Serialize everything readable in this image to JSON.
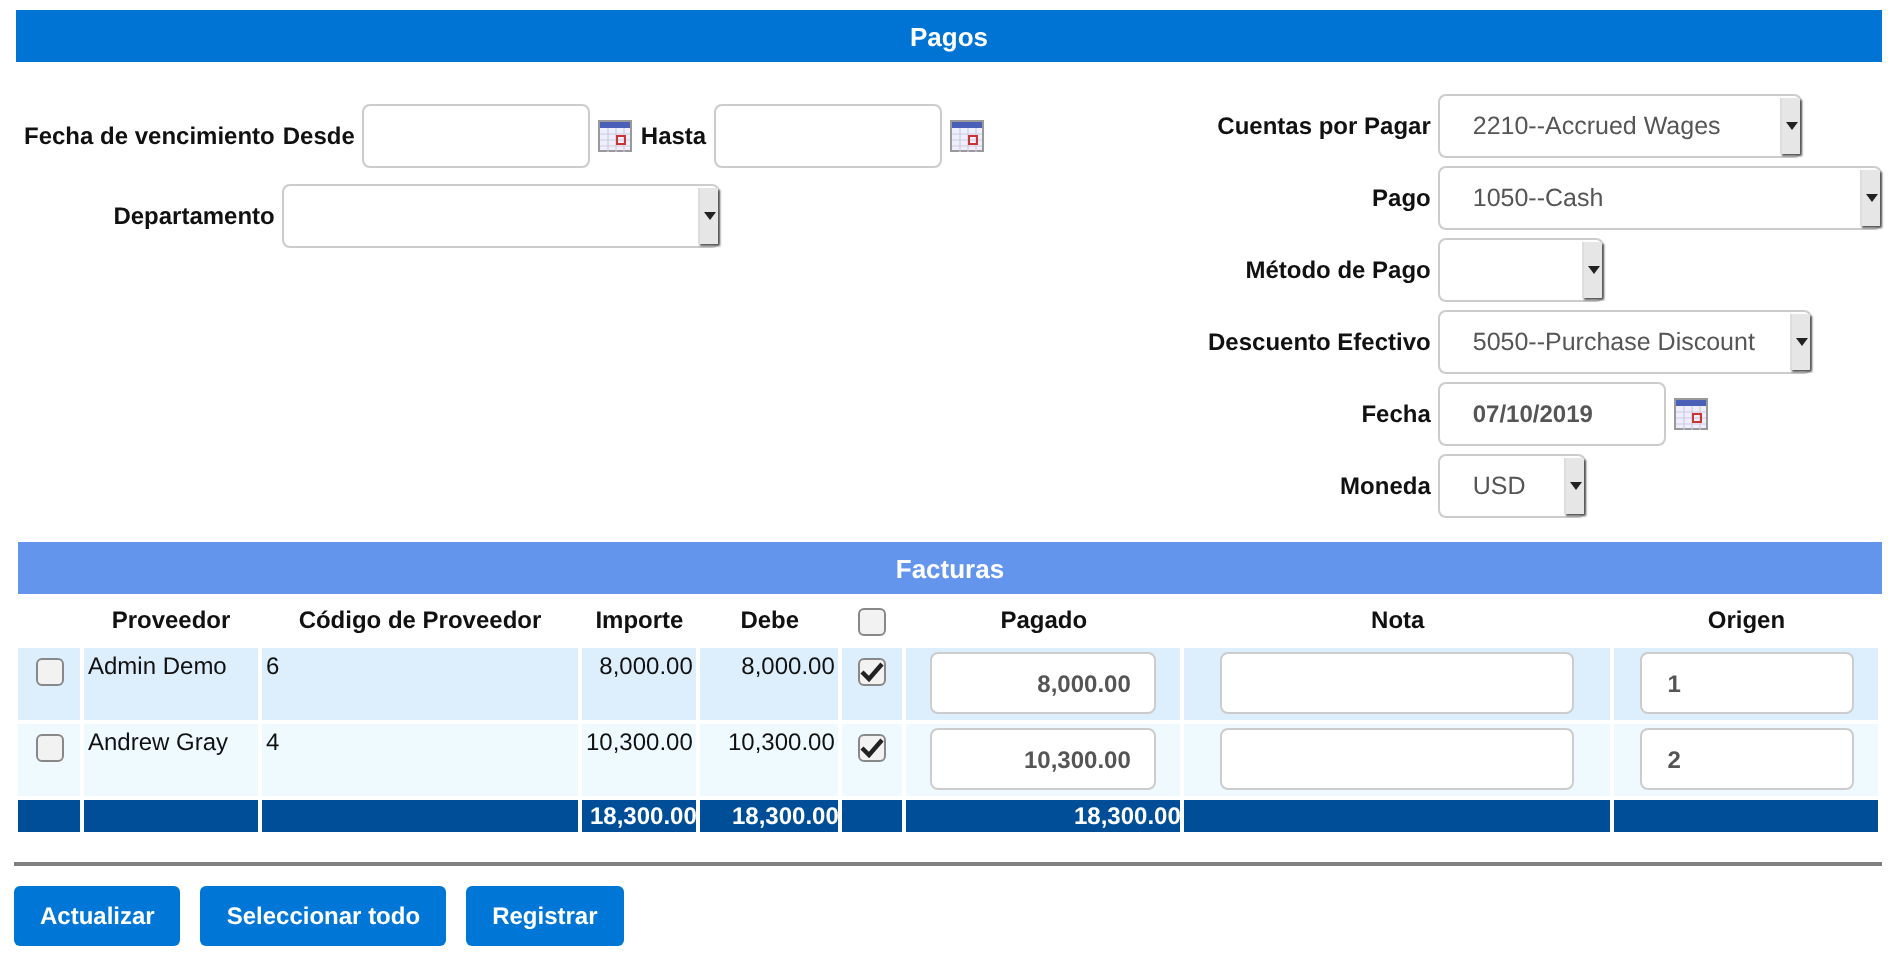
{
  "header": {
    "title": "Pagos"
  },
  "filters": {
    "due_label": "Fecha de vencimiento",
    "from_label": "Desde",
    "to_label": "Hasta",
    "department_label": "Departamento"
  },
  "settings": [
    {
      "label": "Cuentas por Pagar",
      "kind": "select",
      "value": "2210--Accrued Wages"
    },
    {
      "label": "Pago",
      "kind": "select",
      "value": "1050--Cash"
    },
    {
      "label": "Método de Pago",
      "kind": "select"
    },
    {
      "label": "Descuento Efectivo",
      "kind": "select",
      "value": "5050--Purchase Discount"
    },
    {
      "label": "Fecha",
      "kind": "date",
      "value": "07/10/2019"
    },
    {
      "label": "Moneda",
      "kind": "select",
      "value": "USD"
    }
  ],
  "invoices": {
    "title": "Facturas",
    "columns": [
      "Proveedor",
      "Código de Proveedor",
      "Importe",
      "Debe",
      "Pagado",
      "Nota",
      "Origen"
    ],
    "all_paid_checked": false,
    "rows": [
      {
        "selected": false,
        "vendor": "Admin Demo",
        "code": "6",
        "amount": "8,000.00",
        "due": "8,000.00",
        "paid_checked": true,
        "paid": "8,000.00",
        "origin": "1"
      },
      {
        "selected": false,
        "vendor": "Andrew Gray",
        "code": "4",
        "amount": "10,300.00",
        "due": "10,300.00",
        "paid_checked": true,
        "paid": "10,300.00",
        "origin": "2"
      }
    ],
    "totals": {
      "amount": "18,300.00",
      "due": "18,300.00",
      "paid": "18,300.00"
    }
  },
  "buttons": [
    "Actualizar",
    "Seleccionar todo",
    "Registrar"
  ]
}
